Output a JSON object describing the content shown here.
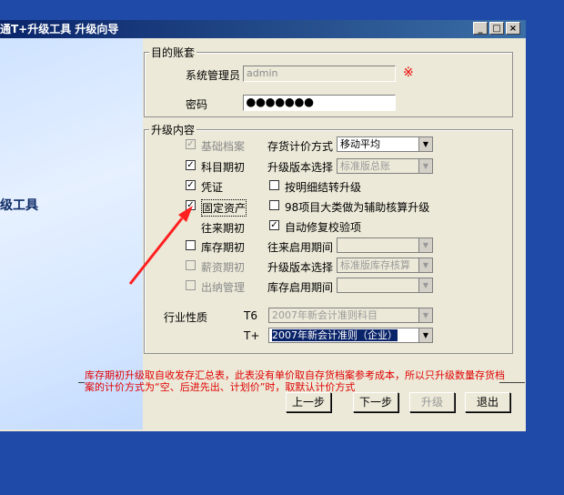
{
  "window": {
    "title": "通T+升级工具   升级向导",
    "btn_min": "_",
    "btn_max": "□",
    "btn_close": "×"
  },
  "left_panel": {
    "label": "级工具"
  },
  "account": {
    "group_title": "目的账套",
    "admin_label": "系统管理员",
    "admin_value": "admin",
    "required_mark": "※",
    "pwd_label": "密码",
    "pwd_value": "●●●●●●●"
  },
  "upgrade": {
    "group_title": "升级内容",
    "left_items": [
      {
        "label": "基础档案",
        "checked": true,
        "disabled": true
      },
      {
        "label": "科目期初",
        "checked": true,
        "disabled": false
      },
      {
        "label": "凭证",
        "checked": true,
        "disabled": false
      },
      {
        "label": "固定资产",
        "checked": true,
        "disabled": false
      },
      {
        "label": "往来期初",
        "checked": false,
        "disabled": false,
        "no_box": true
      },
      {
        "label": "库存期初",
        "checked": false,
        "disabled": false
      },
      {
        "label": "薪资期初",
        "checked": false,
        "disabled": true
      },
      {
        "label": "出纳管理",
        "checked": false,
        "disabled": true
      }
    ],
    "inv_method_label": "存货计价方式",
    "inv_method_value": "移动平均",
    "ver_label": "升级版本选择",
    "ver_value": "标准版总账",
    "detail_label": "按明细结转升级",
    "aux_label": "98项目大类做为辅助核算升级",
    "auto_fix_label": "自动修复校验项",
    "period_label": "往来启用期间",
    "period_value": "",
    "ver2_label": "升级版本选择",
    "ver2_value": "标准版库存核算",
    "stock_period_label": "库存启用期间",
    "stock_period_value": "",
    "industry_label": "行业性质",
    "t6_label": "T6",
    "t6_value": "2007年新会计准则科目",
    "tplus_label": "T+",
    "tplus_value": "2007年新会计准则（企业）"
  },
  "note": "库存期初升级取自收发存汇总表，此表没有单价取自存货档案参考成本，所以只升级数量存货档案的计价方式为“空、后进先出、计划价”时，取默认计价方式",
  "buttons": {
    "prev": "上一步",
    "next": "下一步",
    "upgrade": "升级",
    "exit": "退出"
  }
}
